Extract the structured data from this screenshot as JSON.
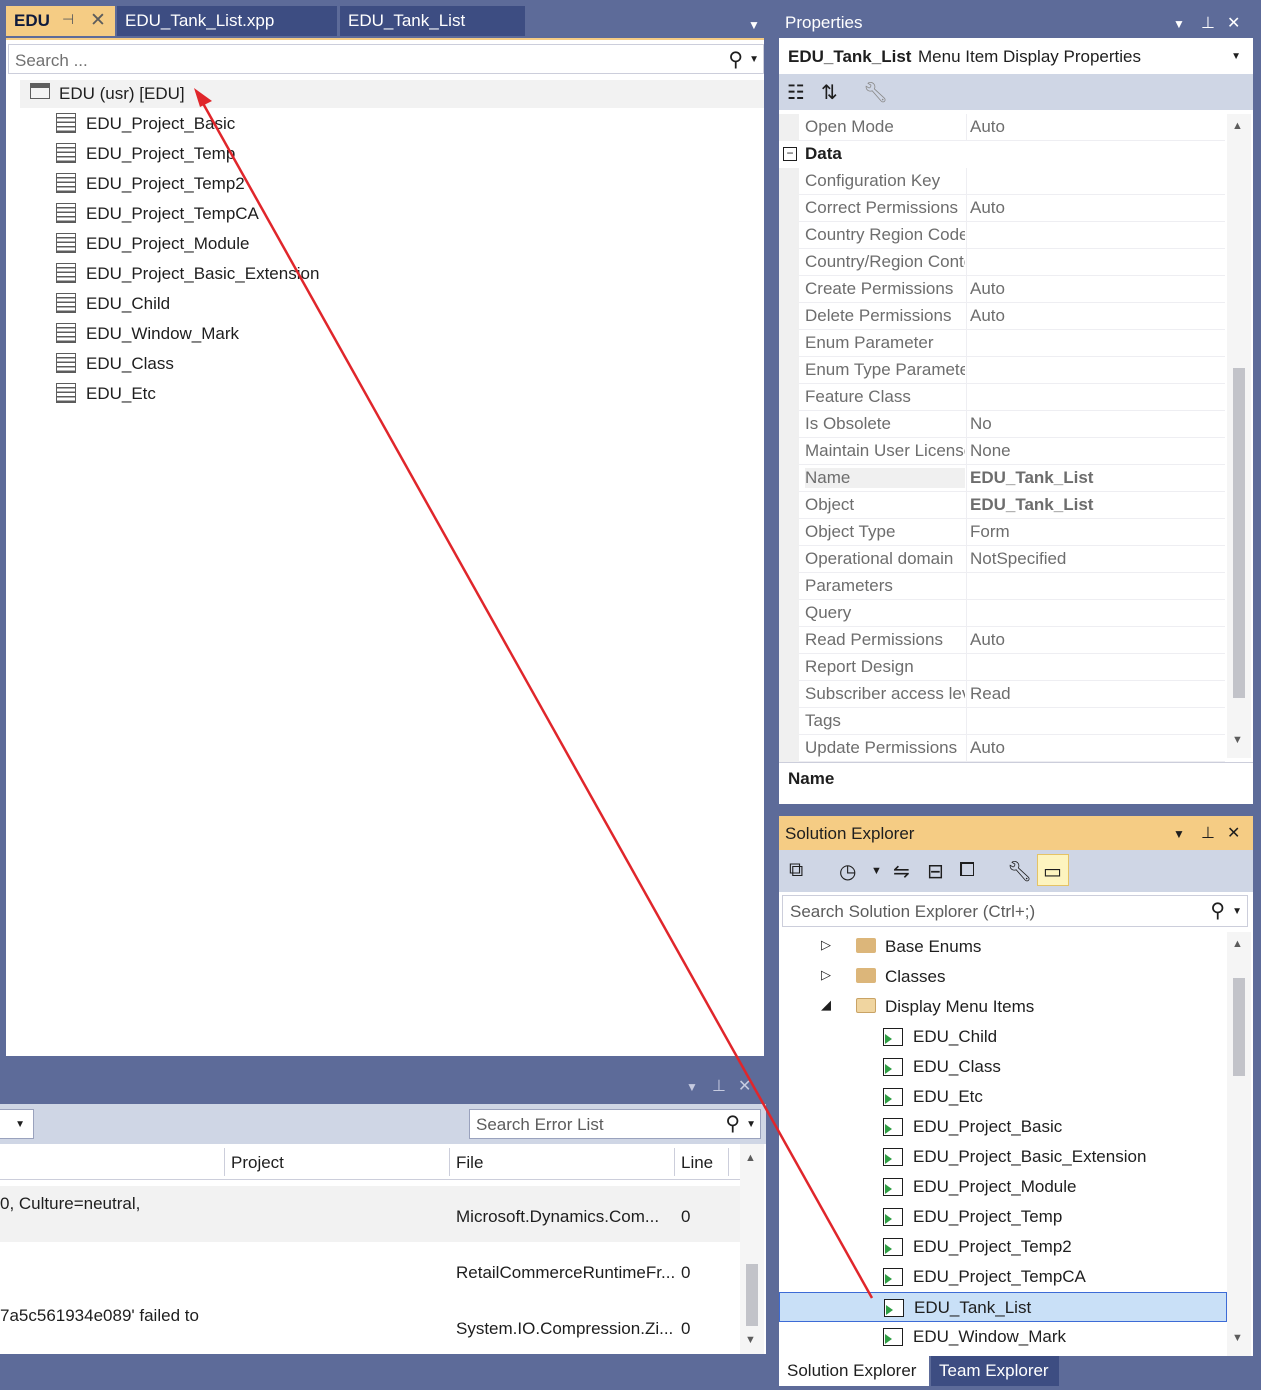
{
  "doc_tabs": {
    "active": "EDU",
    "tab2": "EDU_Tank_List.xpp",
    "tab3": "EDU_Tank_List"
  },
  "doc_search": {
    "placeholder": "Search ..."
  },
  "doc_tree": {
    "root": "EDU (usr) [EDU]",
    "items": [
      "EDU_Project_Basic",
      "EDU_Project_Temp",
      "EDU_Project_Temp2",
      "EDU_Project_TempCA",
      "EDU_Project_Module",
      "EDU_Project_Basic_Extension",
      "EDU_Child",
      "EDU_Window_Mark",
      "EDU_Class",
      "EDU_Etc"
    ]
  },
  "error_list": {
    "search_placeholder": "Search Error List",
    "columns": {
      "project": "Project",
      "file": "File",
      "line": "Line"
    },
    "rows": [
      {
        "desc": "0, Culture=neutral,",
        "file": "Microsoft.Dynamics.Com...",
        "line": "0"
      },
      {
        "desc": "",
        "file": "RetailCommerceRuntimeFr...",
        "line": "0"
      },
      {
        "desc": "7a5c561934e089' failed to",
        "file": "System.IO.Compression.Zi...",
        "line": "0"
      }
    ]
  },
  "properties": {
    "title": "Properties",
    "object_name": "EDU_Tank_List",
    "object_kind": "Menu Item Display Properties",
    "category": "Data",
    "top_row": {
      "name": "Open Mode",
      "value": "Auto"
    },
    "rows": [
      {
        "name": "Configuration Key",
        "value": ""
      },
      {
        "name": "Correct Permissions",
        "value": "Auto"
      },
      {
        "name": "Country Region Codes",
        "value": ""
      },
      {
        "name": "Country/Region Context Field Group",
        "value": ""
      },
      {
        "name": "Create Permissions",
        "value": "Auto"
      },
      {
        "name": "Delete Permissions",
        "value": "Auto"
      },
      {
        "name": "Enum Parameter",
        "value": ""
      },
      {
        "name": "Enum Type Parameter",
        "value": ""
      },
      {
        "name": "Feature Class",
        "value": ""
      },
      {
        "name": "Is Obsolete",
        "value": "No"
      },
      {
        "name": "Maintain User License",
        "value": "None"
      },
      {
        "name": "Name",
        "value": "EDU_Tank_List"
      },
      {
        "name": "Object",
        "value": "EDU_Tank_List"
      },
      {
        "name": "Object Type",
        "value": "Form"
      },
      {
        "name": "Operational domain",
        "value": "NotSpecified"
      },
      {
        "name": "Parameters",
        "value": ""
      },
      {
        "name": "Query",
        "value": ""
      },
      {
        "name": "Read Permissions",
        "value": "Auto"
      },
      {
        "name": "Report Design",
        "value": ""
      },
      {
        "name": "Subscriber access level",
        "value": "Read"
      },
      {
        "name": "Tags",
        "value": ""
      },
      {
        "name": "Update Permissions",
        "value": "Auto"
      }
    ],
    "description_title": "Name"
  },
  "solution_explorer": {
    "title": "Solution Explorer",
    "search_placeholder": "Search Solution Explorer (Ctrl+;)",
    "folders": [
      "Base Enums",
      "Classes",
      "Display Menu Items"
    ],
    "items": [
      "EDU_Child",
      "EDU_Class",
      "EDU_Etc",
      "EDU_Project_Basic",
      "EDU_Project_Basic_Extension",
      "EDU_Project_Module",
      "EDU_Project_Temp",
      "EDU_Project_Temp2",
      "EDU_Project_TempCA",
      "EDU_Tank_List",
      "EDU_Window_Mark"
    ],
    "selected": "EDU_Tank_List",
    "tabs": {
      "active": "Solution Explorer",
      "other": "Team Explorer"
    }
  },
  "colors": {
    "chrome": "#5d6b99",
    "active_tab": "#f5cc84",
    "annotation_arrow": "#e0262b",
    "selection": "#c9e0f7"
  }
}
